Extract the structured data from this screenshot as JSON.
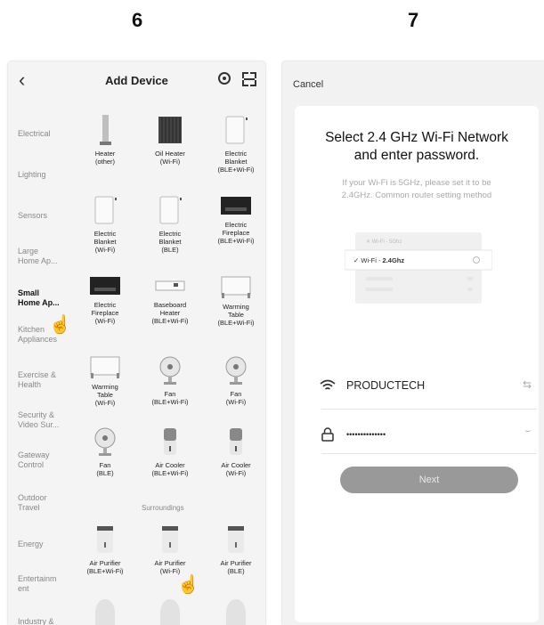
{
  "steps": {
    "left": "6",
    "right": "7"
  },
  "add_device": {
    "title": "Add Device",
    "categories": [
      {
        "label": "Electrical",
        "active": false
      },
      {
        "label": "Lighting",
        "active": false
      },
      {
        "label": "Sensors",
        "active": false
      },
      {
        "label": "Large\nHome Ap...",
        "active": false
      },
      {
        "label": "Small\nHome Ap...",
        "active": true
      },
      {
        "label": "Kitchen\nAppliances",
        "active": false
      },
      {
        "label": "Exercise &\nHealth",
        "active": false
      },
      {
        "label": "Security &\nVideo Sur...",
        "active": false
      },
      {
        "label": "Gateway\nControl",
        "active": false
      },
      {
        "label": "Outdoor\nTravel",
        "active": false
      },
      {
        "label": "Energy",
        "active": false
      },
      {
        "label": "Entertainm\nent",
        "active": false
      },
      {
        "label": "Industry &",
        "active": false
      }
    ],
    "devices": [
      {
        "label": "Heater\n(other)",
        "icon": "heater-icon"
      },
      {
        "label": "Oil Heater\n(Wi-Fi)",
        "icon": "oil-heater-icon"
      },
      {
        "label": "Electric\nBlanket\n(BLE+Wi-Fi)",
        "icon": "electric-blanket-icon"
      },
      {
        "label": "Electric\nBlanket\n(Wi-Fi)",
        "icon": "electric-blanket-icon"
      },
      {
        "label": "Electric\nBlanket\n(BLE)",
        "icon": "electric-blanket-icon"
      },
      {
        "label": "Electric\nFireplace\n(BLE+Wi-Fi)",
        "icon": "fireplace-icon"
      },
      {
        "label": "Electric\nFireplace\n(Wi-Fi)",
        "icon": "fireplace-icon"
      },
      {
        "label": "Baseboard\nHeater\n(BLE+Wi-Fi)",
        "icon": "baseboard-heater-icon"
      },
      {
        "label": "Warming\nTable\n(BLE+Wi-Fi)",
        "icon": "warming-table-icon"
      },
      {
        "label": "Warming\nTable\n(Wi-Fi)",
        "icon": "warming-table-icon"
      },
      {
        "label": "Fan\n(BLE+Wi-Fi)",
        "icon": "fan-icon"
      },
      {
        "label": "Fan\n(Wi-Fi)",
        "icon": "fan-icon"
      },
      {
        "label": "Fan\n(BLE)",
        "icon": "fan-icon"
      },
      {
        "label": "Air Cooler\n(BLE+Wi-Fi)",
        "icon": "air-cooler-icon"
      },
      {
        "label": "Air Cooler\n(Wi-Fi)",
        "icon": "air-cooler-icon"
      }
    ],
    "section_label": "Surroundings",
    "devices2": [
      {
        "label": "Air Purifier\n(BLE+Wi-Fi)",
        "icon": "air-purifier-icon"
      },
      {
        "label": "Air Purifier\n(Wi-Fi)",
        "icon": "air-purifier-icon"
      },
      {
        "label": "Air Purifier\n(BLE)",
        "icon": "air-purifier-icon"
      }
    ]
  },
  "wifi_setup": {
    "cancel": "Cancel",
    "heading": "Select 2.4 GHz Wi-Fi Network\nand enter password.",
    "subtext": "If your Wi-Fi is 5GHz, please set it to be\n2.4GHz. Common router setting method",
    "illustration": {
      "row1": "Wi-Fi - 5Ghz",
      "row2_prefix": "Wi-Fi - ",
      "row2_bold": "2.4Ghz"
    },
    "network_name": "PRODUCTECH",
    "password_mask": "••••••••••••••",
    "next_label": "Next"
  }
}
